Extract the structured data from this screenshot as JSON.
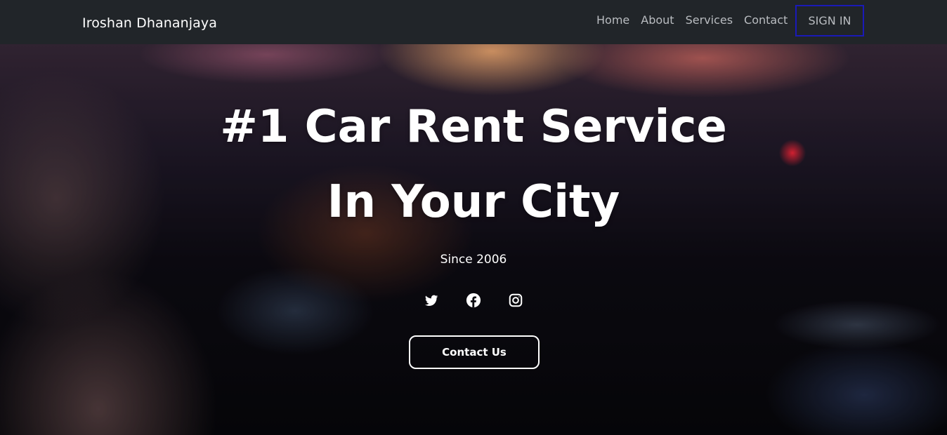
{
  "navbar": {
    "brand": "Iroshan Dhananjaya",
    "links": [
      "Home",
      "About",
      "Services",
      "Contact"
    ],
    "signin_label": "SIGN IN",
    "colors": {
      "background": "#212529",
      "link": "#b9bcc0",
      "signin_border": "#1a1ab8"
    }
  },
  "hero": {
    "headline_line1": "#1 Car Rent Service",
    "headline_line2": "In Your City",
    "since": "Since 2006",
    "social_icons": [
      "twitter-icon",
      "facebook-icon",
      "instagram-icon"
    ],
    "contact_button_label": "Contact Us"
  }
}
